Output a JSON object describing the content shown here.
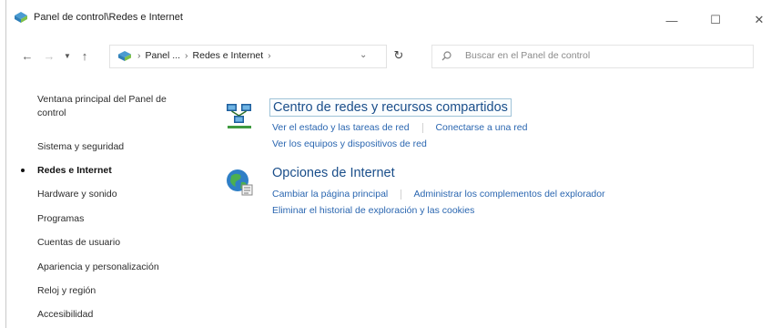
{
  "window": {
    "title": "Panel de control\\Redes e Internet",
    "controls": {
      "minimize": "—",
      "maximize": "☐",
      "close": "✕"
    }
  },
  "toolbar": {
    "back": "←",
    "forward": "→",
    "recent": "▼",
    "up": "↑",
    "breadcrumbs": [
      "Panel ...",
      "Redes e Internet"
    ],
    "crumb_separator": "›",
    "dropdown": "⌄",
    "refresh": "↻",
    "search_placeholder": "Buscar en el Panel de control"
  },
  "sidebar": {
    "home_link": "Ventana principal del Panel de control",
    "items": [
      {
        "label": "Sistema y seguridad",
        "active": false
      },
      {
        "label": "Redes e Internet",
        "active": true
      },
      {
        "label": "Hardware y sonido",
        "active": false
      },
      {
        "label": "Programas",
        "active": false
      },
      {
        "label": "Cuentas de usuario",
        "active": false
      },
      {
        "label": "Apariencia y personalización",
        "active": false
      },
      {
        "label": "Reloj y región",
        "active": false
      },
      {
        "label": "Accesibilidad",
        "active": false
      }
    ]
  },
  "categories": [
    {
      "title": "Centro de redes y recursos compartidos",
      "icon": "network-center-icon",
      "links_row1": [
        "Ver el estado y las tareas de red",
        "Conectarse a una red"
      ],
      "links_row2": [
        "Ver los equipos y dispositivos de red"
      ]
    },
    {
      "title": "Opciones de Internet",
      "icon": "internet-options-icon",
      "links_row1": [
        "Cambiar la página principal",
        "Administrar los complementos del explorador"
      ],
      "links_row2": [
        "Eliminar el historial de exploración y las cookies"
      ]
    }
  ],
  "colors": {
    "link": "#2a66b0",
    "category_title": "#1a4e8a",
    "highlight_border": "#9fc3d8"
  }
}
